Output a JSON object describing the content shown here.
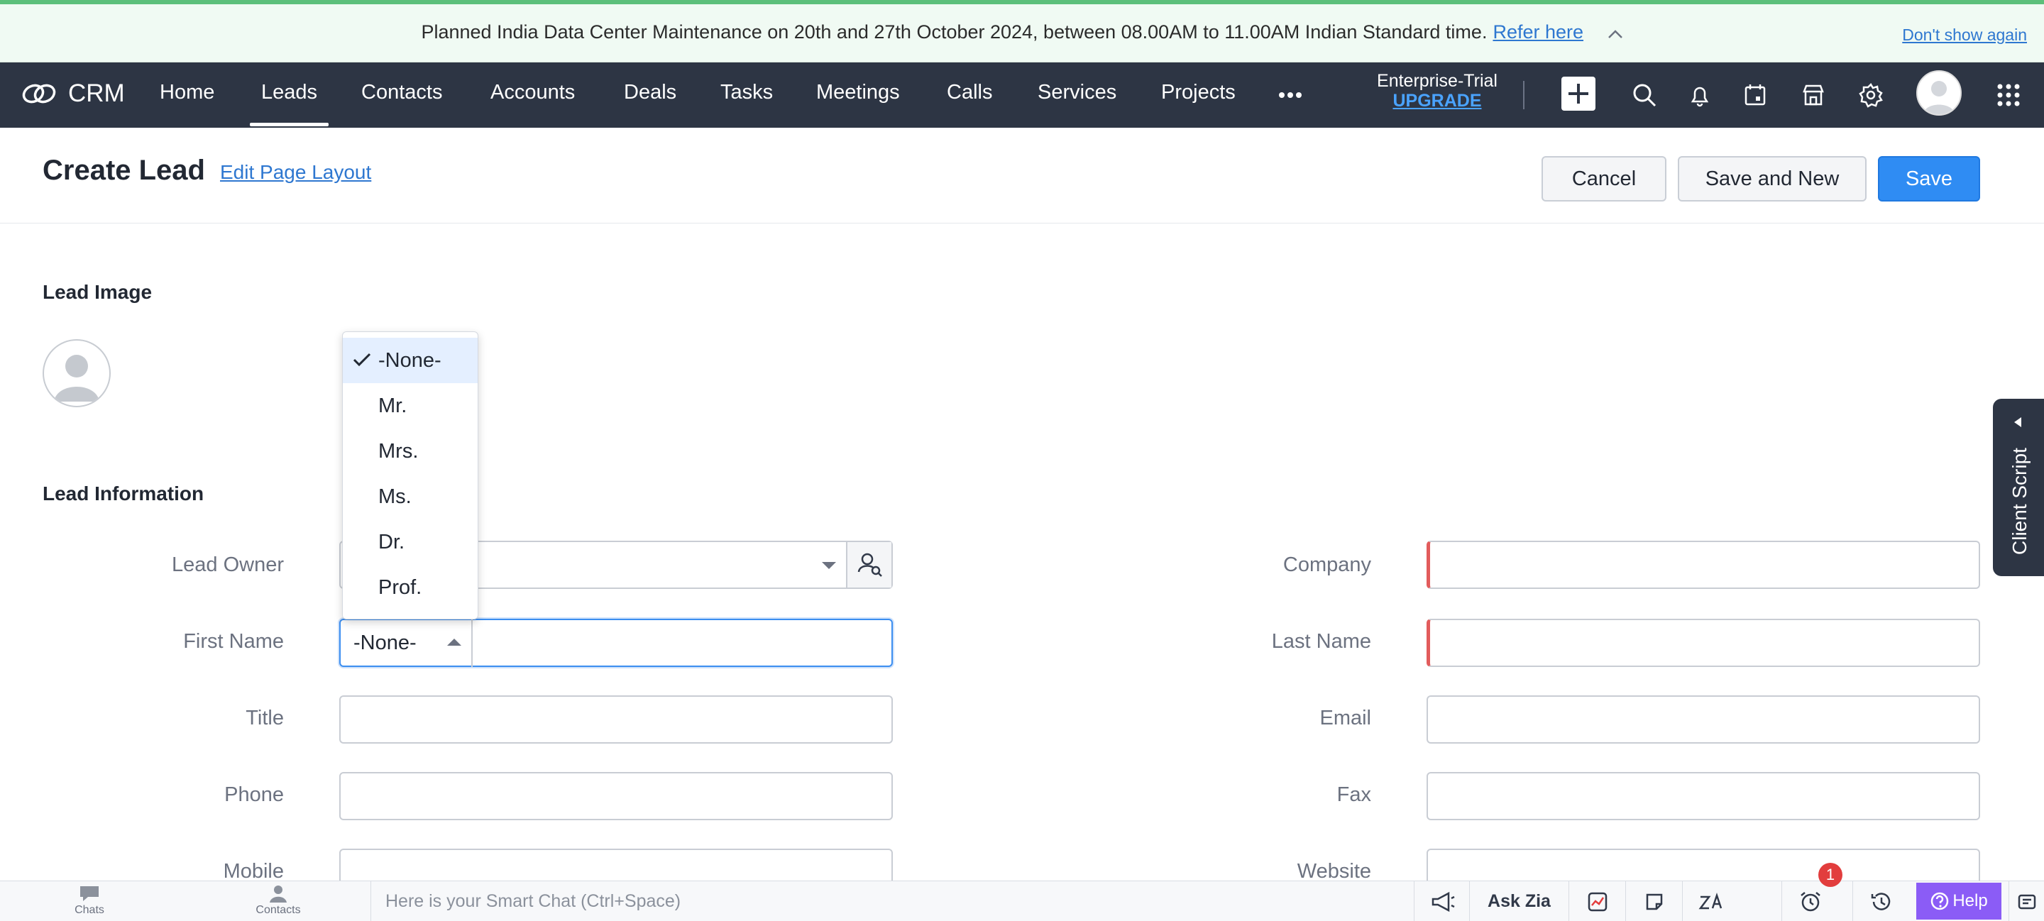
{
  "banner": {
    "message": "Planned India Data Center Maintenance on 20th and 27th October 2024, between 08.00AM to 11.00AM Indian Standard time.",
    "link": "Refer here",
    "dismiss": "Don't show again"
  },
  "nav": {
    "app_name": "CRM",
    "items": [
      "Home",
      "Leads",
      "Contacts",
      "Accounts",
      "Deals",
      "Tasks",
      "Meetings",
      "Calls",
      "Services",
      "Projects"
    ],
    "active": "Leads",
    "trial_label": "Enterprise-Trial",
    "upgrade_label": "UPGRADE"
  },
  "page": {
    "title": "Create Lead",
    "edit_layout": "Edit Page Layout",
    "buttons": {
      "cancel": "Cancel",
      "save_new": "Save and New",
      "save": "Save"
    }
  },
  "sections": {
    "image": "Lead Image",
    "info": "Lead Information"
  },
  "fields": {
    "lead_owner": "Lead Owner",
    "first_name": "First Name",
    "title": "Title",
    "phone": "Phone",
    "mobile": "Mobile",
    "company": "Company",
    "last_name": "Last Name",
    "email": "Email",
    "fax": "Fax",
    "website": "Website"
  },
  "salutation": {
    "value": "-None-",
    "options": [
      "-None-",
      "Mr.",
      "Mrs.",
      "Ms.",
      "Dr.",
      "Prof."
    ],
    "selected": "-None-"
  },
  "client_script": "Client Script",
  "bottom_bar": {
    "chats": "Chats",
    "contacts": "Contacts",
    "smart_chat_placeholder": "Here is your Smart Chat (Ctrl+Space)",
    "ask_zia": "Ask Zia",
    "notification_count": "1",
    "help": "Help"
  },
  "colors": {
    "nav_bg": "#2d3544",
    "primary": "#2f8cf3",
    "link": "#2e77d0",
    "required": "#e25c5c",
    "banner_bg": "#f0faf3"
  }
}
